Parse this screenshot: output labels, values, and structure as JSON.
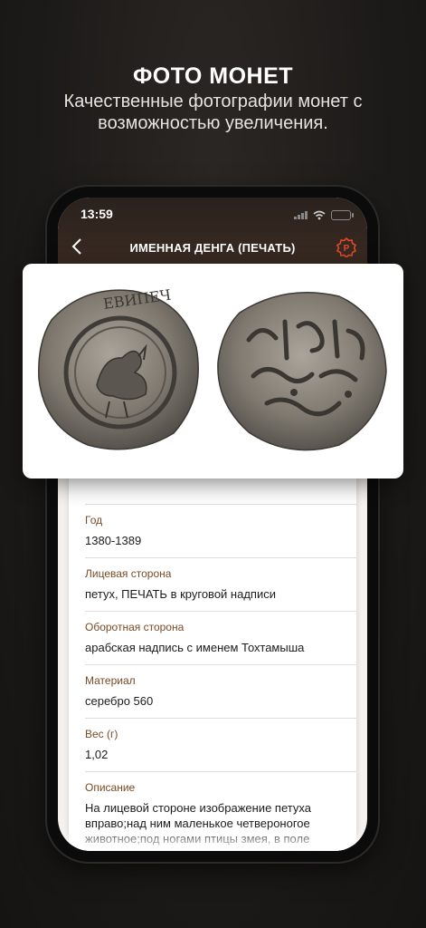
{
  "promo": {
    "title": "ФОТО МОНЕТ",
    "subtitle": "Качественные фотографии монет с возможностью увеличения."
  },
  "status_bar": {
    "time": "13:59"
  },
  "app_bar": {
    "back_icon": "chevron-left-icon",
    "title": "ИМЕННАЯ ДЕНГА (ПЕЧАТЬ)",
    "price_icon": "ruble-badge-icon",
    "price_icon_letter": "Р",
    "accent_color": "#e04a2a"
  },
  "coin_images": [
    {
      "name": "obverse",
      "legend_letters": "ЕВИПЕЧ"
    },
    {
      "name": "reverse"
    }
  ],
  "fields": [
    {
      "label": "Год",
      "value": "1380-1389"
    },
    {
      "label": "Лицевая сторона",
      "value": "петух, ПЕЧАТЬ в круговой надписи"
    },
    {
      "label": "Оборотная сторона",
      "value": "арабская надпись с именем Тохтамыша"
    },
    {
      "label": "Материал",
      "value": "серебро 560"
    },
    {
      "label": "Вес (г)",
      "value": "1,02"
    },
    {
      "label": "Описание",
      "value": "На лицевой стороне изображение петуха вправо;над ним маленькое четвероногое животное;под ногами птицы змея, в поле различные знаки.Круговая надпись ПЕЧАТЬ"
    }
  ],
  "colors": {
    "background": "#1d1b19",
    "label": "#7a4a24",
    "app_bar": "#2f251f"
  }
}
